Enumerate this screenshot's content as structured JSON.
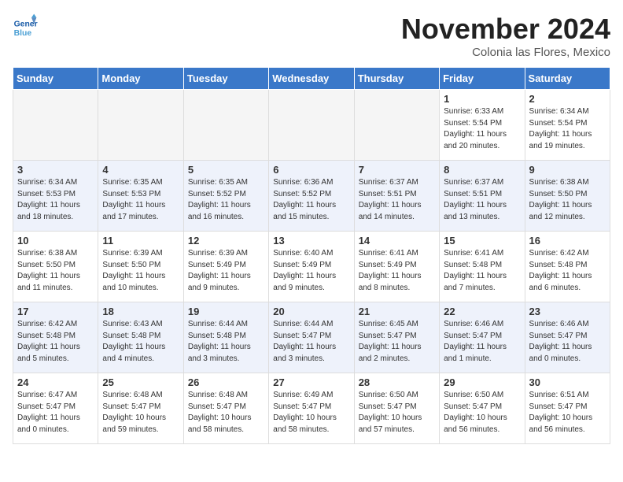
{
  "logo": {
    "line1": "General",
    "line2": "Blue"
  },
  "header": {
    "month": "November 2024",
    "location": "Colonia las Flores, Mexico"
  },
  "weekdays": [
    "Sunday",
    "Monday",
    "Tuesday",
    "Wednesday",
    "Thursday",
    "Friday",
    "Saturday"
  ],
  "weeks": [
    [
      {
        "day": "",
        "info": ""
      },
      {
        "day": "",
        "info": ""
      },
      {
        "day": "",
        "info": ""
      },
      {
        "day": "",
        "info": ""
      },
      {
        "day": "",
        "info": ""
      },
      {
        "day": "1",
        "info": "Sunrise: 6:33 AM\nSunset: 5:54 PM\nDaylight: 11 hours\nand 20 minutes."
      },
      {
        "day": "2",
        "info": "Sunrise: 6:34 AM\nSunset: 5:54 PM\nDaylight: 11 hours\nand 19 minutes."
      }
    ],
    [
      {
        "day": "3",
        "info": "Sunrise: 6:34 AM\nSunset: 5:53 PM\nDaylight: 11 hours\nand 18 minutes."
      },
      {
        "day": "4",
        "info": "Sunrise: 6:35 AM\nSunset: 5:53 PM\nDaylight: 11 hours\nand 17 minutes."
      },
      {
        "day": "5",
        "info": "Sunrise: 6:35 AM\nSunset: 5:52 PM\nDaylight: 11 hours\nand 16 minutes."
      },
      {
        "day": "6",
        "info": "Sunrise: 6:36 AM\nSunset: 5:52 PM\nDaylight: 11 hours\nand 15 minutes."
      },
      {
        "day": "7",
        "info": "Sunrise: 6:37 AM\nSunset: 5:51 PM\nDaylight: 11 hours\nand 14 minutes."
      },
      {
        "day": "8",
        "info": "Sunrise: 6:37 AM\nSunset: 5:51 PM\nDaylight: 11 hours\nand 13 minutes."
      },
      {
        "day": "9",
        "info": "Sunrise: 6:38 AM\nSunset: 5:50 PM\nDaylight: 11 hours\nand 12 minutes."
      }
    ],
    [
      {
        "day": "10",
        "info": "Sunrise: 6:38 AM\nSunset: 5:50 PM\nDaylight: 11 hours\nand 11 minutes."
      },
      {
        "day": "11",
        "info": "Sunrise: 6:39 AM\nSunset: 5:50 PM\nDaylight: 11 hours\nand 10 minutes."
      },
      {
        "day": "12",
        "info": "Sunrise: 6:39 AM\nSunset: 5:49 PM\nDaylight: 11 hours\nand 9 minutes."
      },
      {
        "day": "13",
        "info": "Sunrise: 6:40 AM\nSunset: 5:49 PM\nDaylight: 11 hours\nand 9 minutes."
      },
      {
        "day": "14",
        "info": "Sunrise: 6:41 AM\nSunset: 5:49 PM\nDaylight: 11 hours\nand 8 minutes."
      },
      {
        "day": "15",
        "info": "Sunrise: 6:41 AM\nSunset: 5:48 PM\nDaylight: 11 hours\nand 7 minutes."
      },
      {
        "day": "16",
        "info": "Sunrise: 6:42 AM\nSunset: 5:48 PM\nDaylight: 11 hours\nand 6 minutes."
      }
    ],
    [
      {
        "day": "17",
        "info": "Sunrise: 6:42 AM\nSunset: 5:48 PM\nDaylight: 11 hours\nand 5 minutes."
      },
      {
        "day": "18",
        "info": "Sunrise: 6:43 AM\nSunset: 5:48 PM\nDaylight: 11 hours\nand 4 minutes."
      },
      {
        "day": "19",
        "info": "Sunrise: 6:44 AM\nSunset: 5:48 PM\nDaylight: 11 hours\nand 3 minutes."
      },
      {
        "day": "20",
        "info": "Sunrise: 6:44 AM\nSunset: 5:47 PM\nDaylight: 11 hours\nand 3 minutes."
      },
      {
        "day": "21",
        "info": "Sunrise: 6:45 AM\nSunset: 5:47 PM\nDaylight: 11 hours\nand 2 minutes."
      },
      {
        "day": "22",
        "info": "Sunrise: 6:46 AM\nSunset: 5:47 PM\nDaylight: 11 hours\nand 1 minute."
      },
      {
        "day": "23",
        "info": "Sunrise: 6:46 AM\nSunset: 5:47 PM\nDaylight: 11 hours\nand 0 minutes."
      }
    ],
    [
      {
        "day": "24",
        "info": "Sunrise: 6:47 AM\nSunset: 5:47 PM\nDaylight: 11 hours\nand 0 minutes."
      },
      {
        "day": "25",
        "info": "Sunrise: 6:48 AM\nSunset: 5:47 PM\nDaylight: 10 hours\nand 59 minutes."
      },
      {
        "day": "26",
        "info": "Sunrise: 6:48 AM\nSunset: 5:47 PM\nDaylight: 10 hours\nand 58 minutes."
      },
      {
        "day": "27",
        "info": "Sunrise: 6:49 AM\nSunset: 5:47 PM\nDaylight: 10 hours\nand 58 minutes."
      },
      {
        "day": "28",
        "info": "Sunrise: 6:50 AM\nSunset: 5:47 PM\nDaylight: 10 hours\nand 57 minutes."
      },
      {
        "day": "29",
        "info": "Sunrise: 6:50 AM\nSunset: 5:47 PM\nDaylight: 10 hours\nand 56 minutes."
      },
      {
        "day": "30",
        "info": "Sunrise: 6:51 AM\nSunset: 5:47 PM\nDaylight: 10 hours\nand 56 minutes."
      }
    ]
  ]
}
